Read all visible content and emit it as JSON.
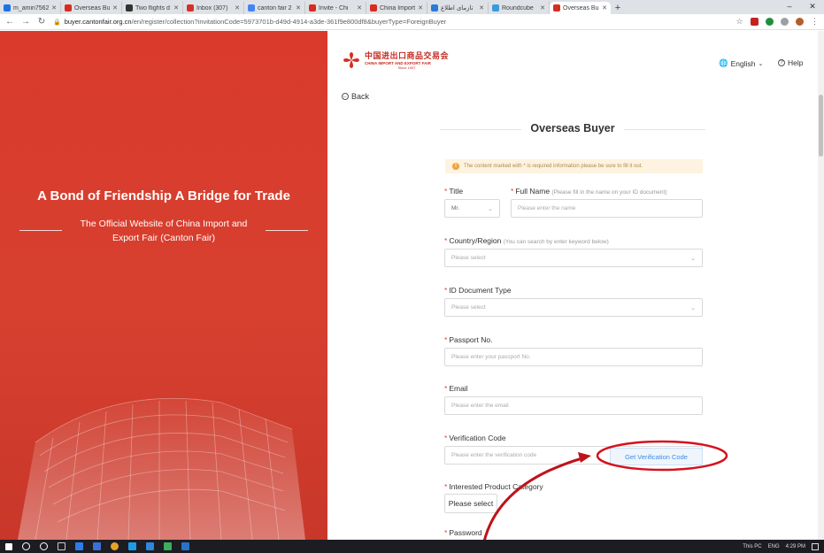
{
  "browser": {
    "tabs": [
      {
        "title": "m_amin7562",
        "favicon_color": "#1a73e8",
        "active": false
      },
      {
        "title": "Overseas Buy",
        "favicon_color": "#d62d20",
        "active": false
      },
      {
        "title": "Two flights d",
        "favicon_color": "#333333",
        "active": false
      },
      {
        "title": "Inbox (307)",
        "favicon_color": "#d93025",
        "active": false
      },
      {
        "title": "canton fair 2",
        "favicon_color": "#4285f4",
        "active": false
      },
      {
        "title": "Invite - Chi",
        "favicon_color": "#d62d20",
        "active": false
      },
      {
        "title": "China Import",
        "favicon_color": "#d62d20",
        "active": false
      },
      {
        "title": "تازمای اطلاع",
        "favicon_color": "#2a7ad6",
        "active": false
      },
      {
        "title": "Roundcube",
        "favicon_color": "#3a9bdc",
        "active": false
      },
      {
        "title": "Overseas Bu",
        "favicon_color": "#d62d20",
        "active": true
      }
    ],
    "new_tab_glyph": "+",
    "url_host": "buyer.cantonfair.org.cn",
    "url_path": "/en/register/collection?invitationCode=5973701b-d49d-4914-a3de-361f9e800df8&buyerType=ForeignBuyer"
  },
  "left_panel": {
    "slogan": "A Bond of Friendship   A Bridge for Trade",
    "subtitle": "The Official Website of China Import and Export Fair (Canton Fair)"
  },
  "header": {
    "logo_cn": "中国进出口商品交易会",
    "logo_en": "CHINA IMPORT AND EXPORT FAIR",
    "logo_since": "Since 1957",
    "language": "English",
    "help": "Help",
    "back": "Back"
  },
  "form": {
    "title": "Overseas Buyer",
    "notice": "The content marked with * is required information please be sure to fill it out.",
    "title_label": "Title",
    "title_value": "Mr.",
    "fullname_label": "Full Name",
    "fullname_hint": "(Please fill in the name on your ID document)",
    "fullname_placeholder": "Please enter the name",
    "country_label": "Country/Region",
    "country_hint": "(You can search by enter keyword below)",
    "country_placeholder": "Please select",
    "idtype_label": "ID Document Type",
    "idtype_placeholder": "Please select",
    "passport_label": "Passport No.",
    "passport_placeholder": "Please enter your passport No.",
    "email_label": "Email",
    "email_placeholder": "Please enter the email",
    "verify_label": "Verification Code",
    "verify_placeholder": "Please enter the verification code",
    "verify_button": "Get Verification Code",
    "category_label": "Interested Product Category",
    "category_button": "Please select",
    "password_label": "Password"
  },
  "taskbar": {
    "tray_text": "This PC",
    "lang": "ENG",
    "time": "4:29 PM"
  },
  "colors": {
    "brand_red": "#d93a2b",
    "required": "#e0463a",
    "link_blue": "#3a8ee6",
    "annotation_red": "#d4121e"
  }
}
